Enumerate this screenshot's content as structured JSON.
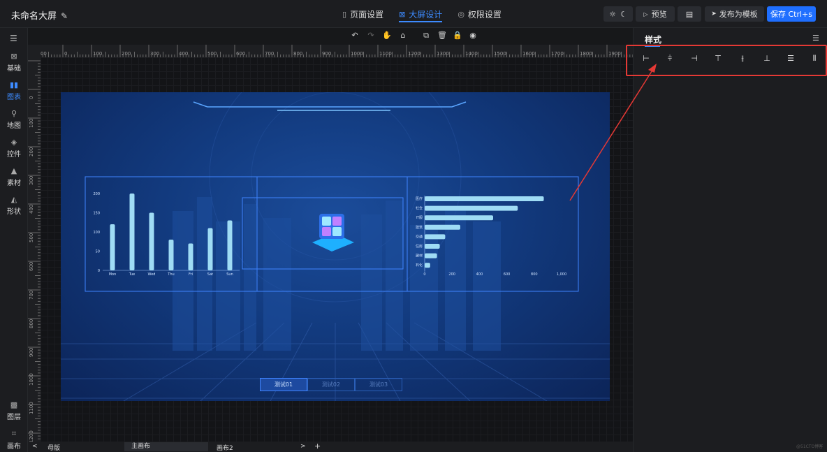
{
  "header": {
    "title": "未命名大屏",
    "nav": [
      {
        "label": "页面设置",
        "icon": "bookmark-icon"
      },
      {
        "label": "大屏设计",
        "icon": "layout-icon",
        "active": true
      },
      {
        "label": "权限设置",
        "icon": "shield-icon"
      }
    ],
    "preview_label": "预览",
    "publish_label": "发布为模板",
    "save_label": "保存 Ctrl+s"
  },
  "sidebar": {
    "items": [
      {
        "label": "基础",
        "icon": "box-icon"
      },
      {
        "label": "图表",
        "icon": "bar-chart-icon",
        "active": true
      },
      {
        "label": "地图",
        "icon": "map-pin-icon"
      },
      {
        "label": "控件",
        "icon": "layers-icon"
      },
      {
        "label": "素材",
        "icon": "shapes-icon"
      },
      {
        "label": "形状",
        "icon": "triangle-icon"
      },
      {
        "label": "图层",
        "icon": "layers-grid-icon"
      },
      {
        "label": "画布",
        "icon": "crop-icon"
      }
    ]
  },
  "ruler": {
    "h_labels": [
      "-100",
      "0",
      "100",
      "200",
      "300",
      "400",
      "500",
      "600",
      "700",
      "800",
      "900",
      "1000",
      "1100",
      "1200",
      "1300",
      "1400",
      "1500",
      "1600",
      "1700",
      "1800",
      "1900"
    ],
    "v_labels": [
      "0",
      "100",
      "200",
      "300",
      "400",
      "500",
      "600",
      "700",
      "800",
      "900",
      "1000",
      "1100",
      "1200"
    ]
  },
  "right_panel": {
    "title": "样式"
  },
  "bottom": {
    "tabs": [
      "母版",
      "主画布",
      "画布2"
    ],
    "prev": "<",
    "next": ">",
    "add": "+"
  },
  "canvas": {
    "buttons": [
      "测试01",
      "测试02",
      "测试03"
    ],
    "active_button": 0
  },
  "chart_data": [
    {
      "type": "bar",
      "categories": [
        "Mon",
        "Tue",
        "Wed",
        "Thu",
        "Fri",
        "Sat",
        "Sun"
      ],
      "values": [
        120,
        200,
        150,
        80,
        70,
        110,
        130
      ],
      "ylim": [
        0,
        200
      ],
      "yticks": [
        "0",
        "50",
        "100",
        "150",
        "200"
      ]
    },
    {
      "type": "bar",
      "orientation": "horizontal",
      "categories": [
        "医疗",
        "社会",
        "IT服",
        "建筑",
        "交通",
        "住房",
        "建材",
        "石化"
      ],
      "values": [
        870,
        680,
        500,
        260,
        150,
        110,
        90,
        40
      ],
      "xlim": [
        0,
        1000
      ],
      "xticks": [
        "0",
        "200",
        "400",
        "600",
        "800",
        "1,000"
      ]
    }
  ],
  "watermark": "@51CTO博客",
  "colors": {
    "accent": "#1f6fff",
    "highlight": "#e53935",
    "bar": "#9fdcf5"
  }
}
